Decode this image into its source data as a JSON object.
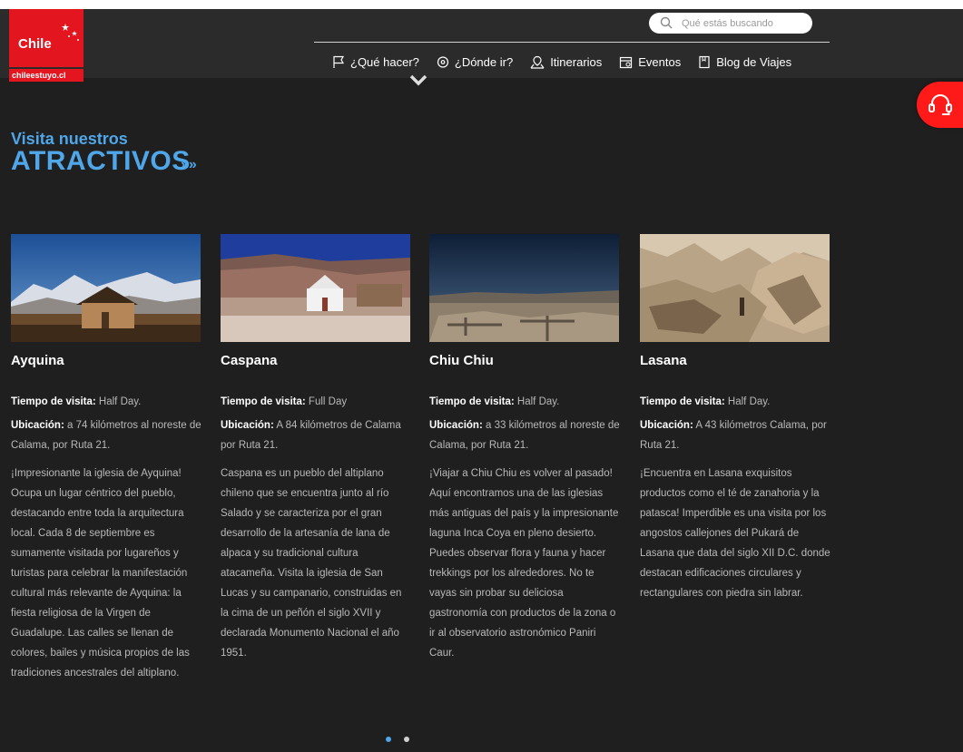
{
  "brand": {
    "logo_text": "Chile",
    "url_badge": "chileestuyo.cl",
    "color": "#e3151f"
  },
  "search": {
    "placeholder": "Qué estás buscando"
  },
  "nav": [
    {
      "label": "¿Qué hacer?",
      "icon": "flag-icon"
    },
    {
      "label": "¿Dónde ir?",
      "icon": "location-icon"
    },
    {
      "label": "Itinerarios",
      "icon": "map-pin-icon"
    },
    {
      "label": "Eventos",
      "icon": "calendar-icon"
    },
    {
      "label": "Blog de Viajes",
      "icon": "book-icon"
    }
  ],
  "section": {
    "subtitle": "Visita nuestros",
    "title": "ATRACTIVOS",
    "arrows": "»»",
    "accent": "#4fa6e8"
  },
  "cards": [
    {
      "title": "Ayquina",
      "visit_label": "Tiempo de visita:",
      "visit_value": " Half Day.",
      "loc_label": "Ubicación:",
      "loc_value": " a 74 kilómetros al noreste de Calama, por Ruta 21.",
      "description": "¡Impresionante la iglesia de Ayquina! Ocupa un lugar céntrico del pueblo, destacando entre toda la arquitectura local. Cada 8 de septiembre es sumamente visitada por lugareños y turistas para celebrar la manifestación cultural más relevante de Ayquina: la fiesta religiosa de la Virgen de Guadalupe. Las calles se llenan de colores, bailes y música propios de las tradiciones ancestrales del altiplano."
    },
    {
      "title": "Caspana",
      "visit_label": "Tiempo de visita:",
      "visit_value": " Full Day",
      "loc_label": "Ubicación:",
      "loc_value": " A 84 kilómetros de Calama por Ruta 21.",
      "description": "Caspana es un pueblo del altiplano chileno que se encuentra junto al río Salado y se caracteriza por el gran desarrollo de la artesanía de lana de alpaca y su tradicional cultura atacameña. Visita la iglesia de San Lucas y su campanario, construidas en la cima de un peñón el siglo XVII y declarada Monumento Nacional el año 1951."
    },
    {
      "title": "Chiu Chiu",
      "visit_label": "Tiempo de visita:",
      "visit_value": " Half Day.",
      "loc_label": "Ubicación:",
      "loc_value": " a 33 kilómetros al noreste de Calama, por Ruta 21.",
      "description": "¡Viajar a Chiu Chiu es volver al pasado! Aquí encontramos una de las iglesias más antiguas del país y la impresionante laguna Inca Coya en pleno desierto. Puedes observar flora y fauna y hacer trekkings por los alrededores. No te vayas sin probar su deliciosa gastronomía con productos de la zona o ir al observatorio astronómico Paniri Caur."
    },
    {
      "title": "Lasana",
      "visit_label": "Tiempo de visita:",
      "visit_value": " Half Day.",
      "loc_label": "Ubicación:",
      "loc_value": " A 43 kilómetros Calama, por Ruta 21.",
      "description": "¡Encuentra en Lasana exquisitos productos como el té de zanahoria y la patasca! Imperdible es una visita por los angostos callejones del Pukará de Lasana que data del siglo XII D.C. donde destacan edificaciones circulares y rectangulares con piedra sin labrar."
    }
  ],
  "pagination": {
    "total": 2,
    "active": 1
  }
}
